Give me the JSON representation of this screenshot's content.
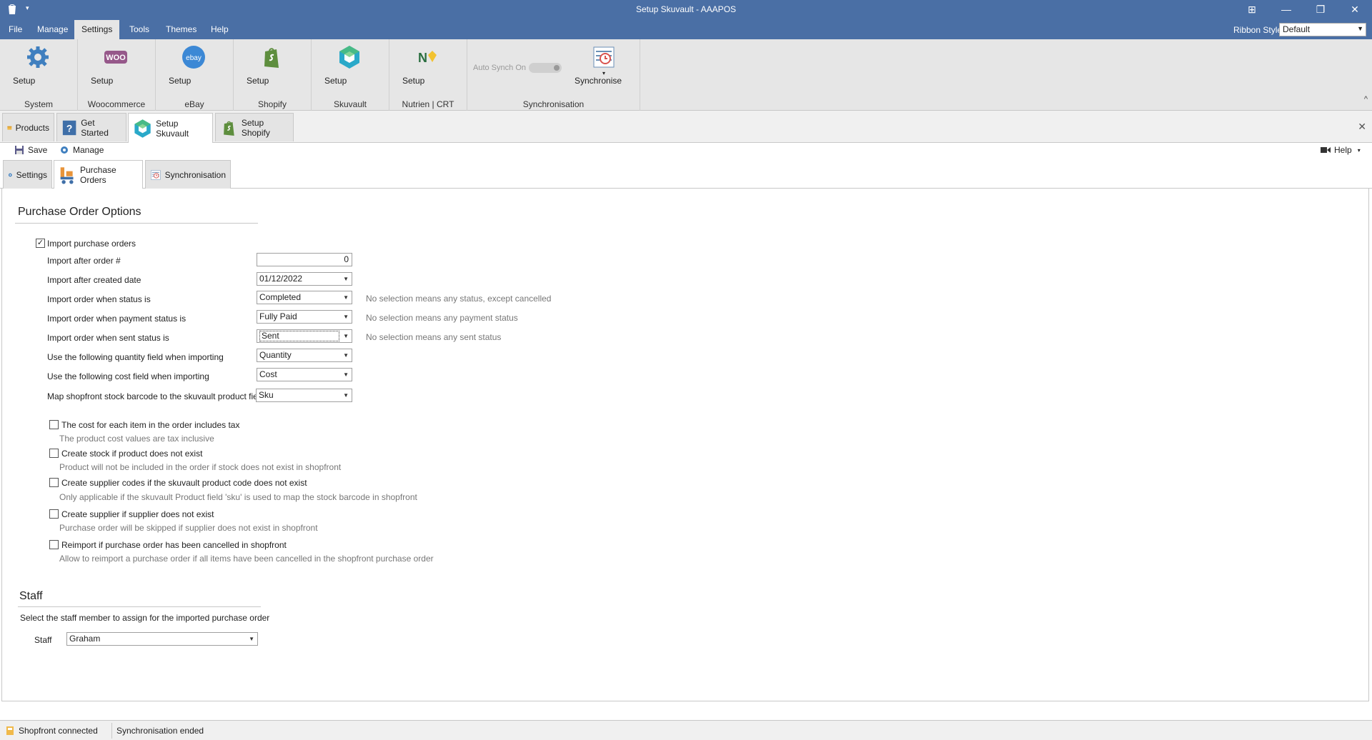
{
  "window": {
    "title": "Setup Skuvault - AAAPOS",
    "qa_arrow": "▾",
    "buttons": {
      "snap": "⊞",
      "minimize": "—",
      "restore": "❐",
      "close": "✕"
    }
  },
  "menu": {
    "items": [
      "File",
      "Manage",
      "Settings",
      "Tools",
      "Themes",
      "Help"
    ],
    "active": "Settings",
    "ribbon_style_label": "Ribbon Style",
    "ribbon_style_value": "Default"
  },
  "ribbon": {
    "groups": [
      {
        "caption": "System",
        "button": "Setup",
        "icon": "gear-icon"
      },
      {
        "caption": "Woocommerce",
        "button": "Setup",
        "icon": "woocommerce-icon"
      },
      {
        "caption": "eBay",
        "button": "Setup",
        "icon": "ebay-icon"
      },
      {
        "caption": "Shopify",
        "button": "Setup",
        "icon": "shopify-icon"
      },
      {
        "caption": "Skuvault",
        "button": "Setup",
        "icon": "skuvault-icon"
      },
      {
        "caption": "Nutrien | CRT",
        "button": "Setup",
        "icon": "nutrien-icon"
      }
    ],
    "synchronisation": {
      "caption": "Synchronisation",
      "auto_synch_label": "Auto Synch On",
      "synchronise_label": "Synchronise",
      "woo_text": "WOO",
      "ebay_text": "ebay",
      "nutrien_text": "N"
    },
    "collapse_glyph": "^"
  },
  "doc_tabs": [
    {
      "label": "Products",
      "icon": "products-icon"
    },
    {
      "label": "Get Started",
      "icon": "help-book-icon"
    },
    {
      "label": "Setup Skuvault",
      "icon": "skuvault-icon",
      "active": true
    },
    {
      "label": "Setup Shopify",
      "icon": "shopify-icon"
    }
  ],
  "close_glyph": "✕",
  "toolbar": {
    "save": "Save",
    "manage": "Manage",
    "help": "Help",
    "help_arrow": "▾"
  },
  "sub_tabs": [
    {
      "label": "Settings",
      "icon": "gear-icon"
    },
    {
      "label": "Purchase Orders",
      "icon": "purchase-orders-icon",
      "active": true
    },
    {
      "label": "Synchronisation",
      "icon": "synchronisation-icon"
    }
  ],
  "purchase_order_options": {
    "title": "Purchase Order Options",
    "import_checkbox": {
      "label": "Import purchase orders",
      "checked": true,
      "glyph": "✓"
    },
    "fields": [
      {
        "label": "Import after order #",
        "value": "0"
      },
      {
        "label": "Import after created date",
        "value": "01/12/2022"
      },
      {
        "label": "Import order when status is",
        "value": "Completed",
        "hint": "No selection means any status, except cancelled"
      },
      {
        "label": "Import order when payment status is",
        "value": "Fully Paid",
        "hint": "No selection means any payment status"
      },
      {
        "label": "Import order when sent status is",
        "value": "Sent",
        "hint": "No selection means any sent status"
      },
      {
        "label": "Use the following quantity field when importing",
        "value": "Quantity"
      },
      {
        "label": "Use the following cost field when importing",
        "value": "Cost"
      },
      {
        "label": "Map shopfront stock barcode to the skuvault product field",
        "value": "Sku"
      }
    ],
    "dropdown_arrow": "▼",
    "options": [
      {
        "label": "The cost for each item in the order includes tax",
        "desc": "The product cost values are tax inclusive",
        "checked": false
      },
      {
        "label": "Create stock if product does not exist",
        "desc": "Product will not be included in the order if stock does not exist in shopfront",
        "checked": false
      },
      {
        "label": "Create supplier codes if the skuvault product code does not exist",
        "desc": "Only applicable if the skuvault Product field 'sku' is used to map the stock barcode in shopfront",
        "checked": false
      },
      {
        "label": "Create supplier if supplier does not exist",
        "desc": "Purchase order will be skipped if supplier does not exist in shopfront",
        "checked": false
      },
      {
        "label": "Reimport if purchase order has been cancelled in shopfront",
        "desc": "Allow to reimport a purchase order if all items have been cancelled in the shopfront purchase order",
        "checked": false
      }
    ]
  },
  "staff": {
    "title": "Staff",
    "description": "Select the staff member to assign for the imported purchase order",
    "label": "Staff",
    "value": "Graham"
  },
  "status_bar": {
    "connection": "Shopfront connected",
    "sync": "Synchronisation ended"
  },
  "colors": {
    "titlebar": "#4a6fa5",
    "ribbon": "#e6e6e6",
    "shopify": "#5e8e3e",
    "skuvault": "#2aa9c9",
    "woo": "#96588a",
    "ebay": "#3c88d5"
  }
}
